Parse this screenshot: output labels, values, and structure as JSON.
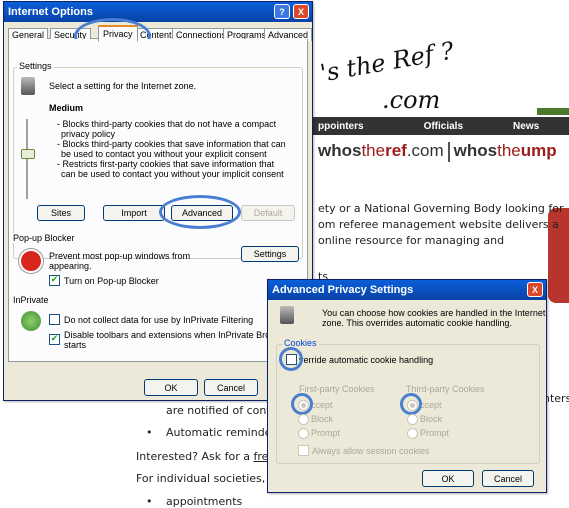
{
  "webpage": {
    "logo_line1": "'s the Ref ?",
    "logo_line2": ".com",
    "nav": [
      "ppointers",
      "Officials",
      "News"
    ],
    "brand_a1": "whos",
    "brand_a2": "the",
    "brand_a3": "ref",
    "brand_a4": ".com",
    "brand_b1": "whos",
    "brand_b2": "the",
    "brand_b3": "ump",
    "para_lines": [
      "ety or a National Governing Body looking for",
      "om referee management website delivers a",
      "online resource for managing and"
    ],
    "frag_ts": "ts",
    "frag_inters": "nters",
    "bullet1": "are notified of confirm",
    "bullet2": "Automatic reminders",
    "interested": "Interested? Ask for a",
    "free": "free de",
    "for_individual": "For individual societies, who",
    "bullet3": "appointments"
  },
  "internet_options": {
    "title": "Internet Options",
    "help_btn": "?",
    "close_btn": "X",
    "tabs": [
      "General",
      "Security",
      "Privacy",
      "Content",
      "Connections",
      "Programs",
      "Advanced"
    ],
    "settings_legend": "Settings",
    "settings_desc": "Select a setting for the Internet zone.",
    "level": "Medium",
    "level_desc": [
      "- Blocks third-party cookies that do not have a compact",
      "privacy policy",
      "- Blocks third-party cookies that save information that can",
      "be used to contact you without your explicit consent",
      "- Restricts first-party cookies that save information that",
      "can be used to contact you without your implicit consent"
    ],
    "sites_btn": "Sites",
    "import_btn": "Import",
    "advanced_btn": "Advanced",
    "default_btn": "Default",
    "popup_legend": "Pop-up Blocker",
    "popup_desc_1": "Prevent most pop-up windows from",
    "popup_desc_2": "appearing.",
    "popup_settings_btn": "Settings",
    "popup_check": "Turn on Pop-up Blocker",
    "inprivate_legend": "InPrivate",
    "inprivate_check1": "Do not collect data for use by InPrivate Filtering",
    "inprivate_check2_1": "Disable toolbars and extensions when InPrivate Brow",
    "inprivate_check2_2": "starts",
    "ok_btn": "OK",
    "cancel_btn": "Cancel"
  },
  "advanced_privacy": {
    "title": "Advanced Privacy Settings",
    "close_btn": "X",
    "desc_1": "You can choose how cookies are handled in the Internet",
    "desc_2": "zone.  This overrides automatic cookie handling.",
    "cookies_legend": "Cookies",
    "override_label": "verride automatic cookie handling",
    "first_party_label": "First-party Cookies",
    "third_party_label": "Third-party Cookies",
    "accept": "ccept",
    "block": "Block",
    "prompt": "Prompt",
    "session": "Always allow session cookies",
    "ok_btn": "OK",
    "cancel_btn": "Cancel"
  },
  "colors": {
    "titlebar": "#0a5fd8",
    "dialog_bg": "#ece9d8",
    "highlight_circle": "#4a7fd0"
  }
}
